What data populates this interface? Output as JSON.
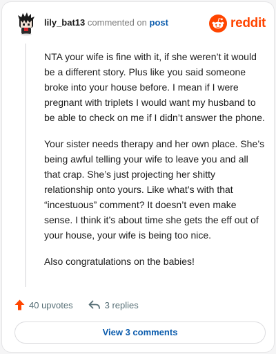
{
  "comment": {
    "username": "lily_bat13",
    "commented_text": "commented on",
    "post_link": "post",
    "paragraphs": [
      "NTA your wife is fine with it, if she weren’t it would be a different story. Plus like you said someone broke into your house before. I mean if I were pregnant with triplets I would want my husband to be able to check on me if I didn’t answer the phone.",
      "Your sister needs therapy and her own place. She’s being awful telling your wife to leave you and all that crap. She’s just projecting her shitty relationship onto yours. Like what’s with that “incestuous” comment? It doesn’t even make sense. I think it’s about time she gets the eff out of your house, your wife is being too nice.",
      "Also congratulations on the babies!"
    ]
  },
  "brand": {
    "wordmark": "reddit",
    "color": "#ff4500"
  },
  "actions": {
    "upvotes": "40 upvotes",
    "replies": "3 replies",
    "upvote_icon": "upvote-arrow-icon",
    "reply_icon": "reply-arrow-icon",
    "upvote_color": "#ff4500"
  },
  "footer": {
    "view_button": "View 3 comments"
  },
  "colors": {
    "link": "#0b5cad",
    "muted": "#7c7c7c",
    "action": "#576f76"
  }
}
